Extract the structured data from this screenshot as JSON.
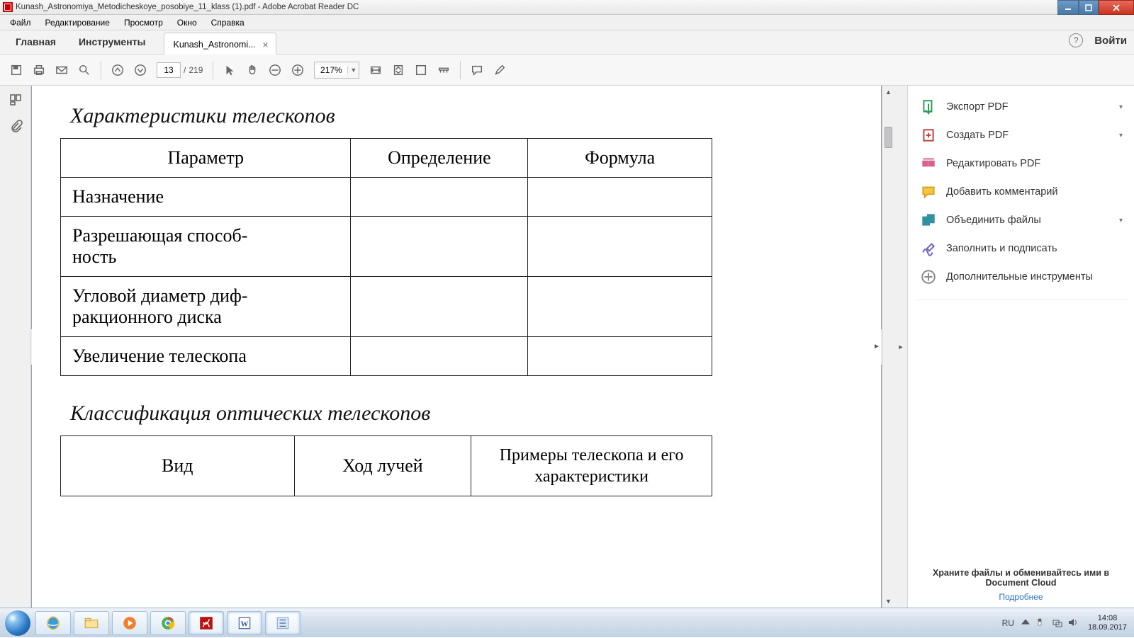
{
  "window": {
    "title": "Kunash_Astronomiya_Metodicheskoye_posobiye_11_klass (1).pdf - Adobe Acrobat Reader DC"
  },
  "menu": {
    "items": [
      "Файл",
      "Редактирование",
      "Просмотр",
      "Окно",
      "Справка"
    ]
  },
  "tabs": {
    "home": "Главная",
    "tools": "Инструменты",
    "doc": "Kunash_Astronomi...",
    "signin": "Войти"
  },
  "toolbar": {
    "page_current": "13",
    "page_sep": "/",
    "page_total": "219",
    "zoom": "217%"
  },
  "document": {
    "section1_title": "Характеристики телескопов",
    "t1_headers": [
      "Параметр",
      "Определение",
      "Формула"
    ],
    "t1_rows": [
      "Назначение",
      "Разрешающая способ-\nность",
      "Угловой диаметр диф-\nракционного диска",
      "Увеличение телескопа"
    ],
    "section2_title": "Классификация оптических телескопов",
    "t2_headers": [
      "Вид",
      "Ход лучей",
      "Примеры телескопа и его характеристики"
    ]
  },
  "tools_pane": {
    "items": [
      "Экспорт PDF",
      "Создать PDF",
      "Редактировать PDF",
      "Добавить комментарий",
      "Объединить файлы",
      "Заполнить и подписать",
      "Дополнительные инструменты"
    ],
    "promo_line1": "Храните файлы и обменивайтесь ими в",
    "promo_line2": "Document Cloud",
    "promo_link": "Подробнее"
  },
  "tray": {
    "lang": "RU",
    "time": "14:08",
    "date": "18.09.2017"
  }
}
